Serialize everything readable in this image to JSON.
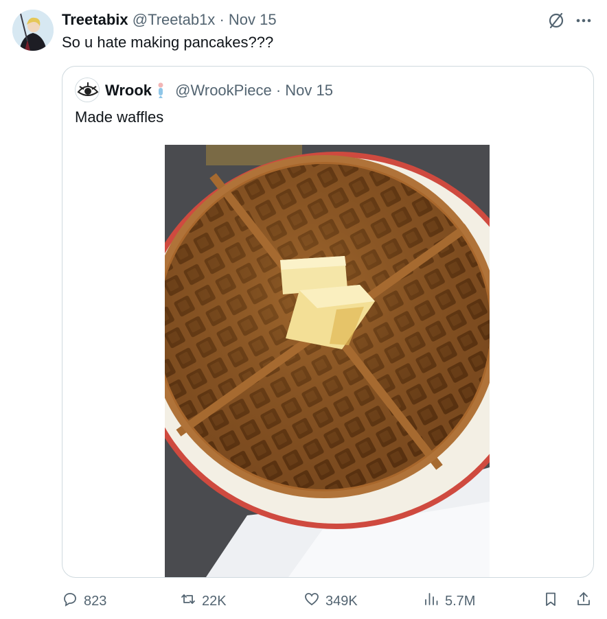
{
  "tweet": {
    "display_name": "Treetabix",
    "handle": "@Treetab1x",
    "separator": "·",
    "date": "Nov 15",
    "text": "So u hate making pancakes???"
  },
  "quoted_tweet": {
    "display_name": "Wrook",
    "handle": "@WrookPiece",
    "separator": "·",
    "date": "Nov 15",
    "text": "Made waffles"
  },
  "actions": {
    "replies": "823",
    "reposts": "22K",
    "likes": "349K",
    "views": "5.7M"
  },
  "icons": [
    "grok-icon",
    "more-icon",
    "reply-icon",
    "repost-icon",
    "like-icon",
    "views-icon",
    "bookmark-icon",
    "share-icon",
    "verified-badge-icon"
  ],
  "colors": {
    "text": "#0f1419",
    "muted": "#536471",
    "border": "#cfd9de"
  }
}
